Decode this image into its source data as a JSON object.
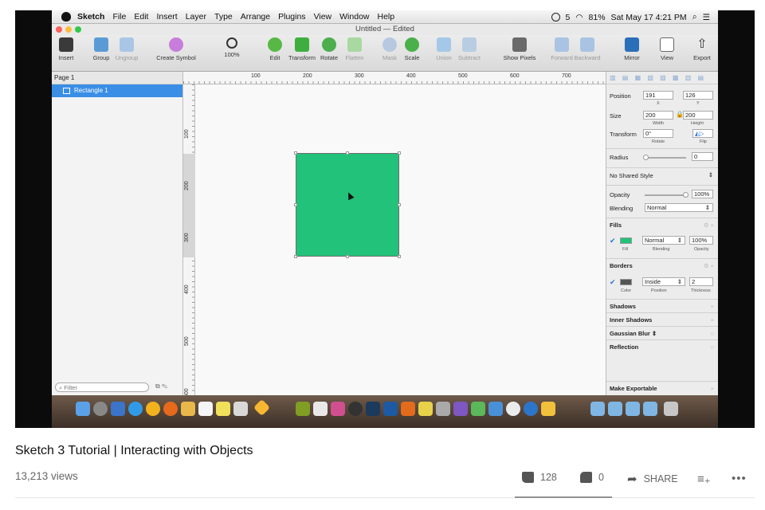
{
  "menubar": {
    "app": "Sketch",
    "items": [
      "File",
      "Edit",
      "Insert",
      "Layer",
      "Type",
      "Arrange",
      "Plugins",
      "View",
      "Window",
      "Help"
    ],
    "battery": "81%",
    "clock": "Sat May 17  4:21 PM",
    "status_count": "5"
  },
  "window": {
    "title": "Untitled — Edited"
  },
  "toolbar": {
    "insert": "Insert",
    "group": "Group",
    "ungroup": "Ungroup",
    "create_symbol": "Create Symbol",
    "zoom": "100%",
    "edit": "Edit",
    "transform": "Transform",
    "rotate": "Rotate",
    "flatten": "Flatten",
    "mask": "Mask",
    "scale": "Scale",
    "union": "Union",
    "subtract": "Subtract",
    "show_pixels": "Show Pixels",
    "forward": "Forward",
    "backward": "Backward",
    "mirror": "Mirror",
    "view": "View",
    "export": "Export"
  },
  "layers": {
    "page": "Page 1",
    "items": [
      "Rectangle 1"
    ],
    "filter_placeholder": "Filter"
  },
  "rulers": {
    "top": [
      "100",
      "200",
      "300",
      "400",
      "500",
      "600",
      "700"
    ],
    "left": [
      "100",
      "200",
      "300",
      "400",
      "500",
      "600"
    ]
  },
  "inspector": {
    "position_label": "Position",
    "x": "191",
    "y": "126",
    "x_sub": "X",
    "y_sub": "Y",
    "size_label": "Size",
    "width": "200",
    "height": "200",
    "width_sub": "Width",
    "height_sub": "Height",
    "transform_label": "Transform",
    "rotate": "0°",
    "rotate_sub": "Rotate",
    "flip_sub": "Flip",
    "radius_label": "Radius",
    "radius": "0",
    "shared_style": "No Shared Style",
    "opacity_label": "Opacity",
    "opacity": "100%",
    "blending_label": "Blending",
    "blending": "Normal",
    "fills_label": "Fills",
    "fill_blend": "Normal",
    "fill_opacity": "100%",
    "fill_sub": "Fill",
    "fill_blend_sub": "Blending",
    "fill_opacity_sub": "Opacity",
    "borders_label": "Borders",
    "border_position": "Inside",
    "border_thickness": "2",
    "border_color_sub": "Color",
    "border_position_sub": "Position",
    "border_thickness_sub": "Thickness",
    "shadows": "Shadows",
    "inner_shadows": "Inner Shadows",
    "gaussian_blur": "Gaussian Blur ⇕",
    "reflection": "Reflection",
    "make_exportable": "Make Exportable"
  },
  "colors": {
    "shape_fill": "#22c27a",
    "selection_blue": "#3a8ee6",
    "border_swatch": "#555555"
  },
  "video": {
    "title": "Sketch 3 Tutorial | Interacting with Objects",
    "views": "13,213 views",
    "likes": "128",
    "dislikes": "0",
    "like_ratio": 1.0,
    "share": "SHARE"
  }
}
